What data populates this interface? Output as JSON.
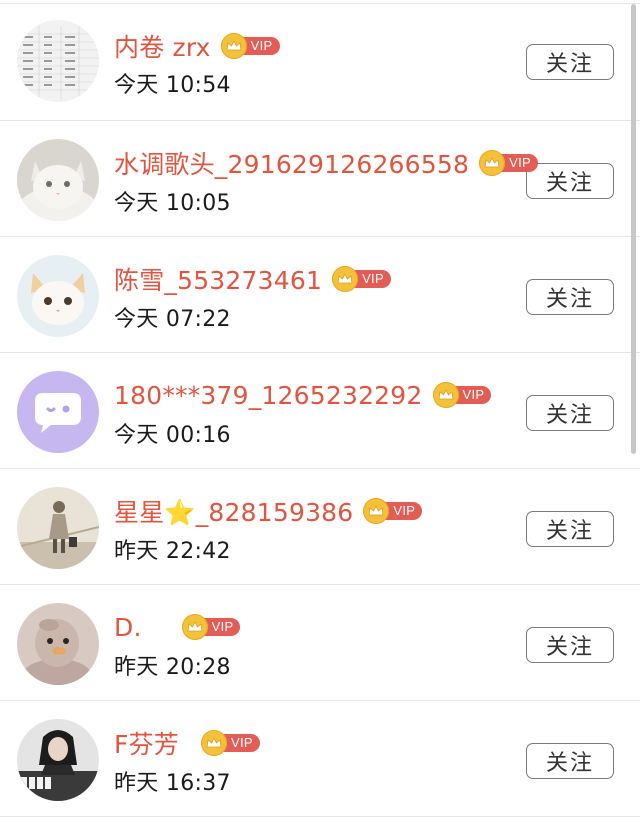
{
  "follow_label": "关注",
  "vip_label": "VIP",
  "users": [
    {
      "name": "内卷 zrx",
      "time": "今天 10:54",
      "avatar": "spreadsheet-thumbnail"
    },
    {
      "name": "水调歌头_291629126266558",
      "time": "今天 10:05",
      "avatar": "white-cat"
    },
    {
      "name": "陈雪_553273461",
      "time": "今天 07:22",
      "avatar": "kitten"
    },
    {
      "name": "180***379_1265232292",
      "time": "今天 00:16",
      "avatar": "default-chat-bubble"
    },
    {
      "name": "星星⭐_828159386",
      "time": "昨天 22:42",
      "avatar": "walking-figure"
    },
    {
      "name": "D.",
      "time": "昨天 20:28",
      "avatar": "plush-duck"
    },
    {
      "name": "F芬芳",
      "time": "昨天 16:37",
      "avatar": "girl-with-piano"
    }
  ],
  "colors": {
    "name": "#e0553f",
    "vip_tag": "#e25d55",
    "crown": "#f4c23a"
  }
}
